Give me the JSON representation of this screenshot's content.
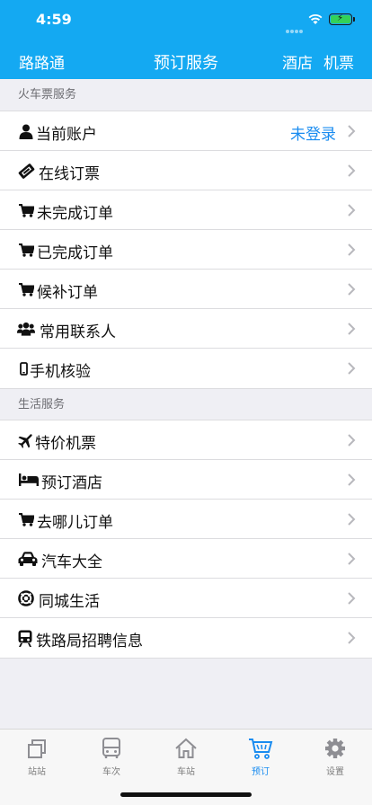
{
  "status_bar": {
    "time": "4:59"
  },
  "nav": {
    "left": "路路通",
    "title": "预订服务",
    "right_hotel": "酒店",
    "right_flight": "机票"
  },
  "sections": [
    {
      "header": "火车票服务",
      "items": [
        {
          "label": "当前账户",
          "value": "未登录",
          "icon": "user-icon"
        },
        {
          "label": "在线订票",
          "icon": "ticket-icon"
        },
        {
          "label": "未完成订单",
          "icon": "cart-icon"
        },
        {
          "label": "已完成订单",
          "icon": "cart-icon"
        },
        {
          "label": "候补订单",
          "icon": "cart-icon"
        },
        {
          "label": "常用联系人",
          "icon": "users-icon"
        },
        {
          "label": "手机核验",
          "icon": "mobile-icon"
        }
      ]
    },
    {
      "header": "生活服务",
      "items": [
        {
          "label": "特价机票",
          "icon": "plane-icon"
        },
        {
          "label": "预订酒店",
          "icon": "bed-icon"
        },
        {
          "label": "去哪儿订单",
          "icon": "cart-icon"
        },
        {
          "label": "汽车大全",
          "icon": "car-icon"
        },
        {
          "label": "同城生活",
          "icon": "lifebuoy-icon"
        },
        {
          "label": "铁路局招聘信息",
          "icon": "train-icon"
        }
      ]
    }
  ],
  "tabbar": {
    "items": [
      {
        "label": "站站",
        "icon": "copy-icon",
        "active": false
      },
      {
        "label": "车次",
        "icon": "bus-icon",
        "active": false
      },
      {
        "label": "车站",
        "icon": "house-icon",
        "active": false
      },
      {
        "label": "预订",
        "icon": "shopping-cart-icon",
        "active": true
      },
      {
        "label": "设置",
        "icon": "gear-icon",
        "active": false
      }
    ]
  },
  "colors": {
    "accent": "#14a9f2",
    "link": "#1a8cf0",
    "background": "#efeff4",
    "battery": "#33d158"
  }
}
